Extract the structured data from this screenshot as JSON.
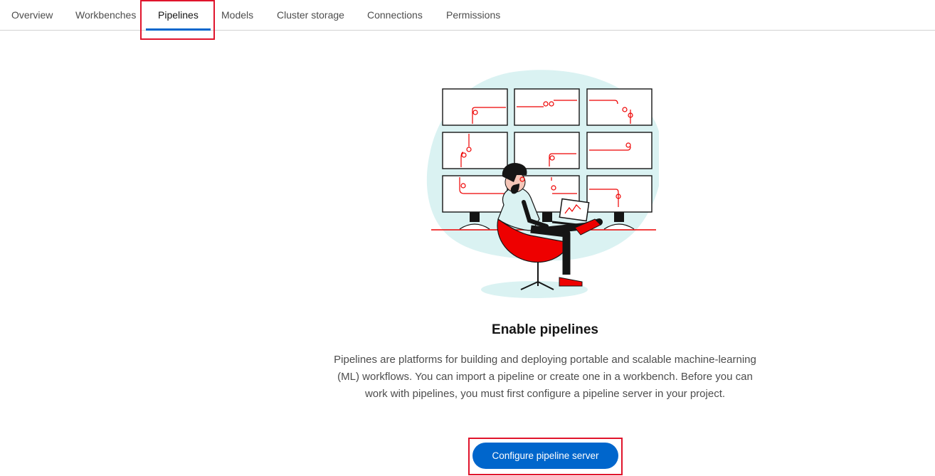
{
  "tabs": [
    {
      "label": "Overview",
      "active": false
    },
    {
      "label": "Workbenches",
      "active": false
    },
    {
      "label": "Pipelines",
      "active": true
    },
    {
      "label": "Models",
      "active": false
    },
    {
      "label": "Cluster storage",
      "active": false
    },
    {
      "label": "Connections",
      "active": false
    },
    {
      "label": "Permissions",
      "active": false
    }
  ],
  "empty_state": {
    "illustration": "person-at-monitors-illustration",
    "title": "Enable pipelines",
    "description": "Pipelines are platforms for building and deploying portable and scalable machine-learning (ML) workflows. You can import a pipeline or create one in a workbench. Before you can work with pipelines, you must first configure a pipeline server in your project.",
    "button_label": "Configure pipeline server"
  },
  "colors": {
    "accent": "#0066cc",
    "highlight": "#e0142c",
    "illustration_red": "#ee0000",
    "illustration_teal": "#daf2f2"
  }
}
